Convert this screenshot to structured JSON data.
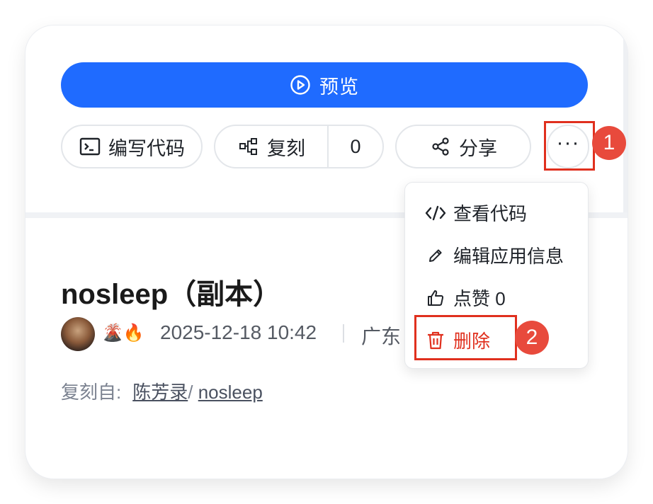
{
  "toolbar": {
    "preview_label": "预览",
    "code_label": "编写代码",
    "fork_label": "复刻",
    "fork_count": "0",
    "share_label": "分享",
    "more_label": "···"
  },
  "annotations": {
    "step1": "1",
    "step2": "2"
  },
  "menu": {
    "items": [
      {
        "label": "查看代码",
        "icon": "code-icon"
      },
      {
        "label": "编辑应用信息",
        "icon": "pencil-icon"
      },
      {
        "label": "点赞 0",
        "icon": "thumbs-up-icon"
      },
      {
        "label": "删除",
        "icon": "trash-icon"
      }
    ]
  },
  "app": {
    "title": "nosleep（副本）",
    "emoji": "🌋🔥",
    "timestamp": "2025-12-18 10:42",
    "location": "广东",
    "fork_from_label": "复刻自:",
    "fork_from_author": "陈芳录",
    "fork_from_sep": "/",
    "fork_from_app": "nosleep"
  },
  "colors": {
    "primary": "#1f6bff",
    "danger": "#e0301e",
    "badge": "#e84a3c"
  }
}
